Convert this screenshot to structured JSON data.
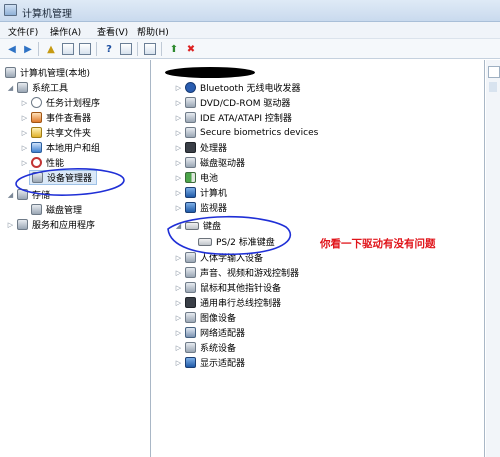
{
  "window": {
    "title": "计算机管理"
  },
  "menu": [
    "文件(F)",
    "操作(A)",
    "查看(V)",
    "帮助(H)"
  ],
  "toolbar_icons": [
    "back-icon",
    "forward-icon",
    "up-folder-icon",
    "show-hide-tree-icon",
    "properties-icon",
    "help-icon",
    "view-icon",
    "refresh-icon",
    "update-driver-icon",
    "uninstall-icon"
  ],
  "tree": {
    "root": "计算机管理(本地)",
    "system_tools": "系统工具",
    "task_scheduler": "任务计划程序",
    "event_viewer": "事件查看器",
    "shared_folders": "共享文件夹",
    "local_users": "本地用户和组",
    "performance": "性能",
    "device_manager": "设备管理器",
    "storage": "存储",
    "disk_management": "磁盘管理",
    "services_apps": "服务和应用程序"
  },
  "devices": [
    "Bluetooth 无线电收发器",
    "DVD/CD-ROM 驱动器",
    "IDE ATA/ATAPI 控制器",
    "Secure biometrics devices",
    "处理器",
    "磁盘驱动器",
    "电池",
    "计算机",
    "监视器",
    "键盘",
    "PS/2 标准键盘",
    "人体学输入设备",
    "声音、视频和游戏控制器",
    "鼠标和其他指针设备",
    "通用串行总线控制器",
    "图像设备",
    "网络适配器",
    "系统设备",
    "显示适配器"
  ],
  "annotation": "你看一下驱动有没有问题",
  "colors": {
    "annotation_red": "#e0141a",
    "annotation_blue": "#1f2fd6"
  }
}
